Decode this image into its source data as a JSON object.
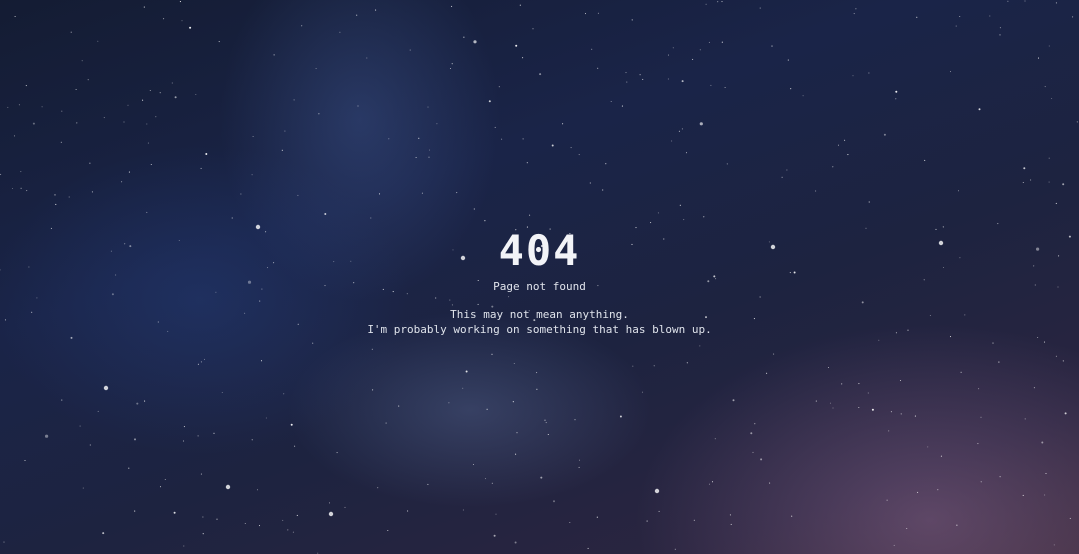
{
  "error": {
    "code": "404",
    "title": "Page not found",
    "message_lines": [
      "This may not mean anything.",
      "I'm probably working on something that has blown up."
    ]
  },
  "background": {
    "image": "starry-night-sky",
    "colors": [
      "#141c33",
      "#1a2448",
      "#2a2540",
      "#3a2a3c"
    ]
  }
}
